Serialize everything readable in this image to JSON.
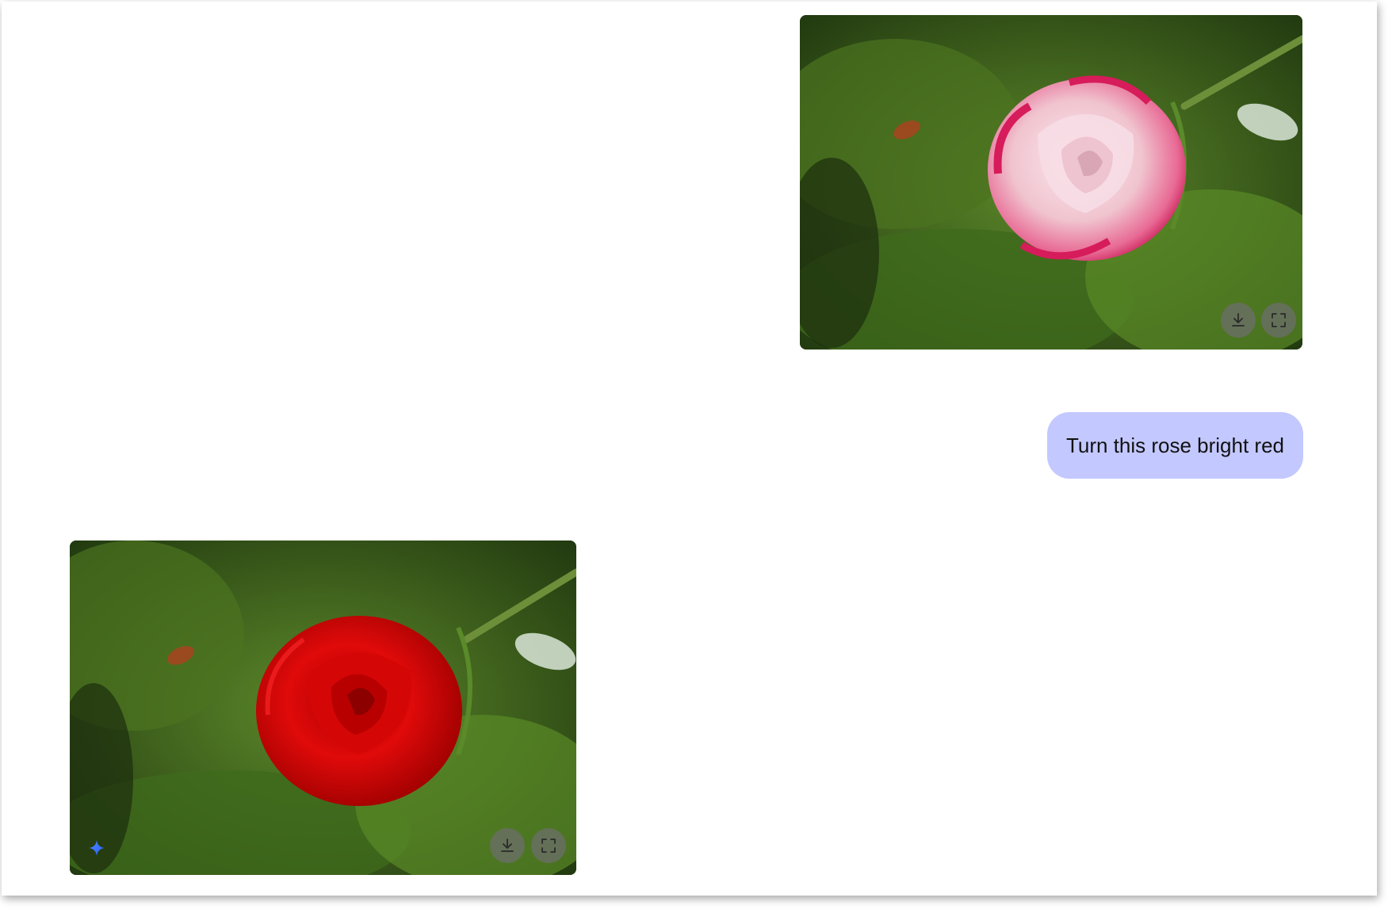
{
  "conversation": {
    "user_message": {
      "image_icon_buttons": [
        "download-icon",
        "fullscreen-icon"
      ],
      "text": "Turn this rose bright red",
      "bubble_color": "#c3c8ff"
    },
    "model_response": {
      "image_icon_buttons": [
        "download-icon",
        "fullscreen-icon"
      ],
      "badge_icon": "sparkle-icon"
    }
  },
  "colors": {
    "original_rose": "#f0c4cf",
    "original_rose_edge": "#d81d5c",
    "edited_rose": "#e00a0a",
    "moss": "#4f7a23"
  }
}
